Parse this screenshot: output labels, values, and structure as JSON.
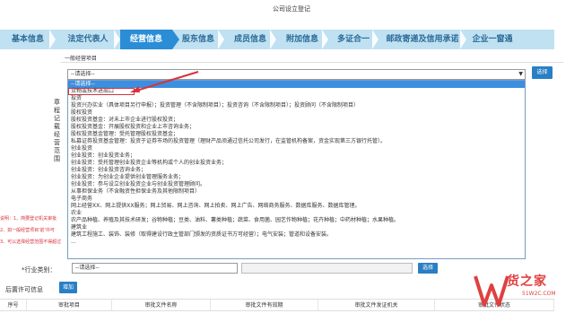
{
  "page": {
    "title": "公司设立登记"
  },
  "steps": [
    {
      "label": "基本信息",
      "active": false
    },
    {
      "label": "法定代表人",
      "active": false
    },
    {
      "label": "经营信息",
      "active": true
    },
    {
      "label": "股东信息",
      "active": false
    },
    {
      "label": "成员信息",
      "active": false
    },
    {
      "label": "附加信息",
      "active": false
    },
    {
      "label": "多证合一",
      "active": false
    },
    {
      "label": "邮政寄递及信用承诺",
      "active": false
    },
    {
      "label": "企业一窗通",
      "active": false
    }
  ],
  "general_scope": {
    "label": "一般经营项目",
    "select_value": "--请选择--",
    "select_button": "选择",
    "side_label": "章程记载经营范围"
  },
  "dropdown": {
    "items": [
      "--请选择--",
      "货物或技术进出口",
      "投资",
      "投资兴办实业（具体项目另行申报）；投资管理（不含限制项目）；投资咨询（不含限制项目）；投资顾问（不含限制项目）",
      "股权投资",
      "股权投资基金：对未上市企业进行股权投资；",
      "股权投资基金：开展股权投资和企业上市咨询业务；",
      "股权投资基金管理：受托管理股权投资基金；",
      "私募证券投资基金管理：投资于证券市场的投资管理（理财产品须通过信托公司发行，在监管机构备案，资金实现第三方银行托管）。",
      "创业投资",
      "创业投资：创业投资业务；",
      "创业投资：受托管理创业投资企业等机构或个人的创业投资业务；",
      "创业投资：创业投资咨询业务；",
      "创业投资：为创业企业提供创业管理服务业务；",
      "创业投资：参与设立创业投资企业与创业投资管理顾问。",
      "从事担保业务（不含融资性担保业务及其他限制项目）",
      "电子商务",
      "网上经营XX、网上提供XX服务；网上贸易、网上咨询、网上拍卖、网上广告、网络商务服务、数据库服务、数据库管理。",
      "农业",
      "农产品种植、养殖及其技术研发；谷物种植；豆类、油料、薯类种植；蔬菜、食用菌、园艺作物种植；花卉种植；中药材种植；水果种植。",
      "建筑业",
      "建筑工程施工、装饰、装修（取得建设行政主管部门颁发的资质证书方可经营）；电气安装；管道和设备安装。",
      "..."
    ],
    "highlighted_index": 0,
    "boxed_index": 1
  },
  "notes": [
    "说明：1、简要登记机关审批",
    "2、如一般经营项目'前'许可",
    "3、可以选择经营范围不得超过"
  ],
  "industry": {
    "label": "*行业类别：",
    "select_value": "--请选择--",
    "button": "选择"
  },
  "permit": {
    "label": "后置许可信息",
    "add_button": "增加"
  },
  "table": {
    "headers": [
      "序号",
      "审批项目",
      "审批文件名称",
      "审批文件有效期",
      "审批文件发证机关",
      "审批文件状态"
    ]
  },
  "watermark": {
    "text": "货之家",
    "url": "51W2C.COM"
  },
  "colors": {
    "accent": "#2b8dd6",
    "steps_bg": "#bfe1f2",
    "highlight": "#3b8fe0",
    "warn": "#d8333d"
  }
}
